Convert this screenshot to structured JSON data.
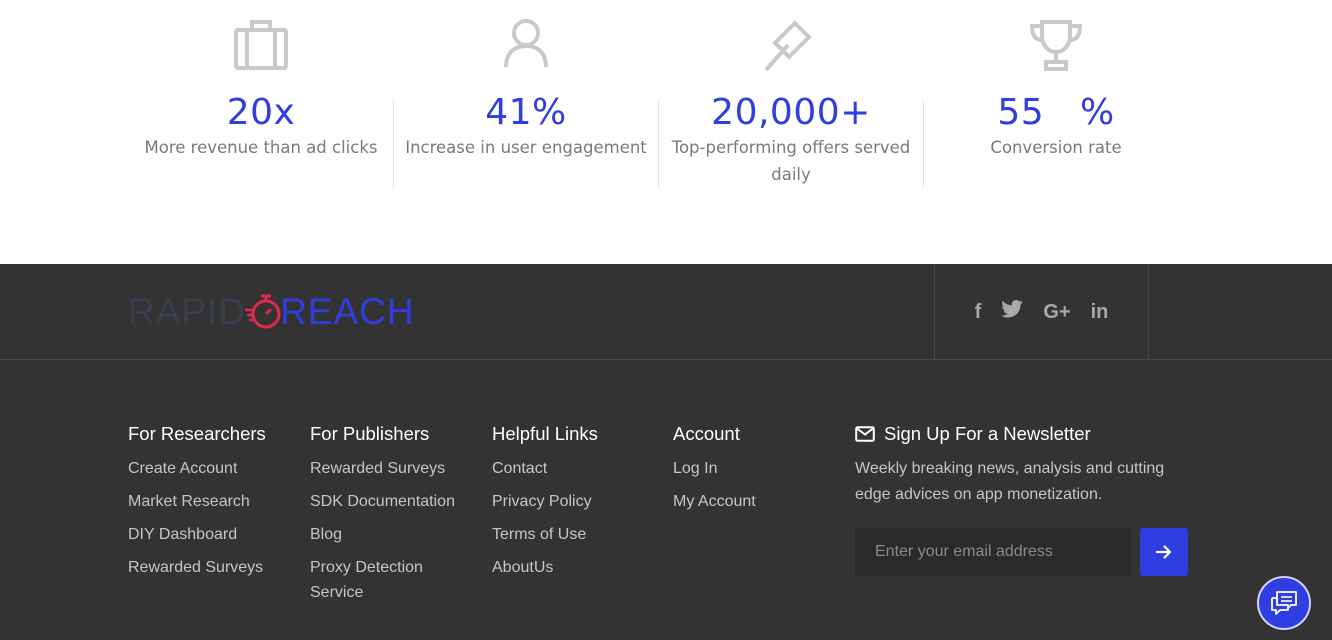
{
  "stats": [
    {
      "icon": "briefcase-icon",
      "value": "20x",
      "label": "More revenue than ad clicks"
    },
    {
      "icon": "user-icon",
      "value": "41%",
      "label": "Increase in user engagement"
    },
    {
      "icon": "gavel-icon",
      "value": "20,000+",
      "label": "Top-performing offers served daily"
    },
    {
      "icon": "trophy-icon",
      "value": "55   %",
      "label": "Conversion rate"
    }
  ],
  "colors": {
    "accent": "#2f3ee0",
    "footer_bg": "#333333",
    "stat_label": "#7a7a7a"
  },
  "logo": {
    "part1": "RAPID",
    "part2": "REACH"
  },
  "social": [
    "f",
    "t",
    "G+",
    "in"
  ],
  "columns": [
    {
      "title": "For Researchers",
      "links": [
        "Create Account",
        "Market Research",
        "DIY Dashboard",
        "Rewarded Surveys"
      ]
    },
    {
      "title": "For Publishers",
      "links": [
        "Rewarded Surveys",
        "SDK Documentation",
        "Blog",
        "Proxy Detection Service"
      ]
    },
    {
      "title": "Helpful Links",
      "links": [
        "Contact",
        "Privacy Policy",
        "Terms of Use",
        "AboutUs"
      ]
    },
    {
      "title": "Account",
      "links": [
        "Log In",
        "My Account"
      ]
    }
  ],
  "newsletter": {
    "title": "Sign Up For a Newsletter",
    "text": "Weekly breaking news, analysis and cutting edge advices on app monetization.",
    "placeholder": "Enter your email address"
  }
}
